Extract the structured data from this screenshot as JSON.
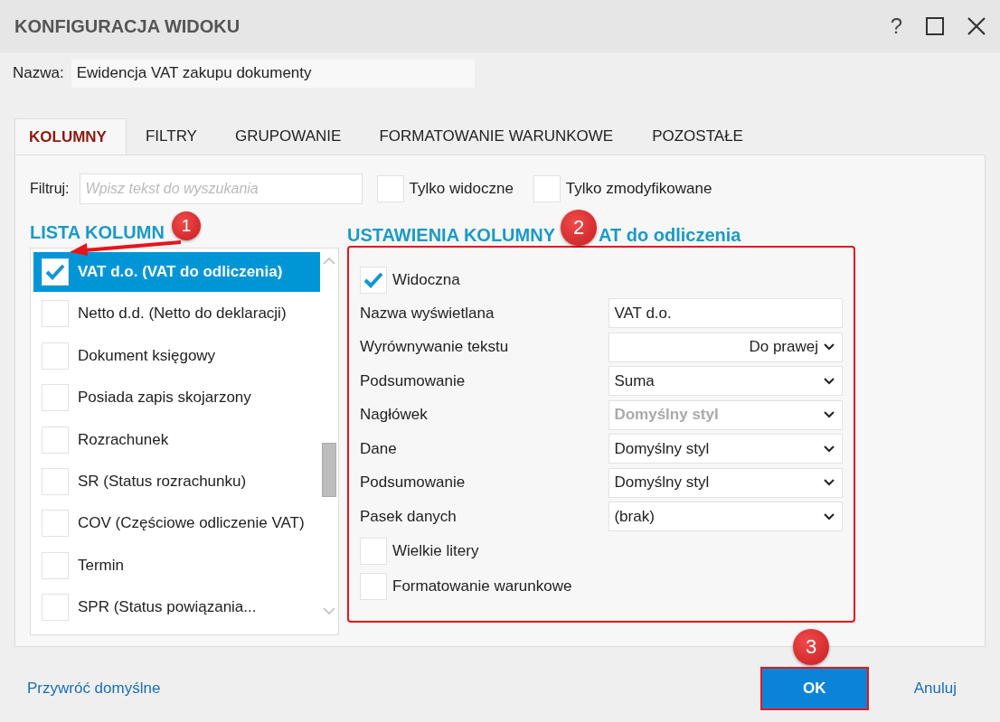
{
  "window": {
    "title": "KONFIGURACJA WIDOKU",
    "help": "?"
  },
  "name_field": {
    "label": "Nazwa:",
    "value": "Ewidencja VAT zakupu dokumenty"
  },
  "tabs": [
    {
      "label": "KOLUMNY",
      "selected": true
    },
    {
      "label": "FILTRY",
      "selected": false
    },
    {
      "label": "GRUPOWANIE",
      "selected": false
    },
    {
      "label": "FORMATOWANIE WARUNKOWE",
      "selected": false
    },
    {
      "label": "POZOSTAŁE",
      "selected": false
    }
  ],
  "filter": {
    "label": "Filtruj:",
    "placeholder": "Wpisz tekst do wyszukania",
    "toggles": [
      {
        "label": "Tylko widoczne",
        "checked": false
      },
      {
        "label": "Tylko zmodyfikowane",
        "checked": false
      }
    ]
  },
  "columns_list": {
    "heading": "LISTA KOLUMN",
    "items": [
      {
        "label": "VAT d.o. (VAT do odliczenia)",
        "checked": true,
        "selected": true
      },
      {
        "label": "Netto d.d. (Netto do deklaracji)",
        "checked": false,
        "selected": false
      },
      {
        "label": "Dokument księgowy",
        "checked": false,
        "selected": false
      },
      {
        "label": "Posiada zapis skojarzony",
        "checked": false,
        "selected": false
      },
      {
        "label": "Rozrachunek",
        "checked": false,
        "selected": false
      },
      {
        "label": "SR (Status rozrachunku)",
        "checked": false,
        "selected": false
      },
      {
        "label": "COV (Częściowe odliczenie VAT)",
        "checked": false,
        "selected": false
      },
      {
        "label": "Termin",
        "checked": false,
        "selected": false
      },
      {
        "label": "SPR (Status powiązania...",
        "checked": false,
        "selected": false
      }
    ]
  },
  "settings": {
    "heading": "USTAWIENIA KOLUMNY",
    "heading_rest": "AT do odliczenia",
    "rows": [
      {
        "kind": "checkbox",
        "label": "Widoczna",
        "checked": true
      },
      {
        "kind": "text",
        "label": "Nazwa wyświetlana",
        "value": "VAT d.o."
      },
      {
        "kind": "select",
        "label": "Wyrównywanie tekstu",
        "value": "Do prawej",
        "right_aligned": true,
        "disabled": false
      },
      {
        "kind": "select",
        "label": "Podsumowanie",
        "value": "Suma",
        "right_aligned": false,
        "disabled": false
      },
      {
        "kind": "select",
        "label": "Nagłówek",
        "value": "Domyślny styl",
        "right_aligned": false,
        "disabled": true
      },
      {
        "kind": "select",
        "label": "Dane",
        "value": "Domyślny styl",
        "right_aligned": false,
        "disabled": false
      },
      {
        "kind": "select",
        "label": "Podsumowanie",
        "value": "Domyślny styl",
        "right_aligned": false,
        "disabled": false
      },
      {
        "kind": "select",
        "label": "Pasek danych",
        "value": "(brak)",
        "right_aligned": false,
        "disabled": false
      },
      {
        "kind": "checkbox",
        "label": "Wielkie litery",
        "checked": false
      },
      {
        "kind": "checkbox",
        "label": "Formatowanie warunkowe",
        "checked": false
      }
    ]
  },
  "footer": {
    "restore": "Przywróć domyślne",
    "ok": "OK",
    "cancel": "Anuluj"
  },
  "annotations": [
    {
      "label": "1"
    },
    {
      "label": "2"
    },
    {
      "label": "3"
    }
  ]
}
